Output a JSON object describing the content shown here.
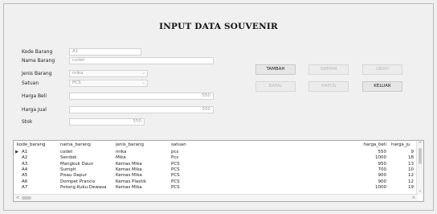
{
  "form": {
    "title": "INPUT DATA SOUVENIR",
    "labels": {
      "kode": "Kode Barang",
      "nama": "Nama Barang",
      "jenis": "Jenis Barang",
      "satuan": "Satuan",
      "harga_beli": "Harga Beli",
      "harga_jual": "Harga Jual",
      "stok": "Stok"
    },
    "values": {
      "kode": "A1",
      "nama": "codet",
      "jenis": "mika",
      "satuan": "PCS",
      "harga_beli": "550",
      "harga_jual": "500",
      "stok": "550"
    }
  },
  "buttons": {
    "tambah": "TAMBAH",
    "simpan": "SIMPAN",
    "ubah": "UBAH",
    "batal": "BATAL",
    "hapus": "HAPUS",
    "keluar": "KELUAR"
  },
  "grid": {
    "columns": [
      "kode_barang",
      "nama_barang",
      "jenis_barang",
      "satuan",
      "harga_beli",
      "harga_ju"
    ],
    "rows": [
      [
        "A1",
        "codet",
        "mika",
        "pcs",
        "550",
        "9"
      ],
      [
        "A2",
        "Sendok",
        "Mika",
        "Pcs",
        "1000",
        "18"
      ],
      [
        "A3",
        "Mangkuk Daun",
        "Kemas Mika",
        "PCS",
        "950",
        "13"
      ],
      [
        "A4",
        "Sumpit",
        "Kemas Mika",
        "PCS",
        "700",
        "10"
      ],
      [
        "A5",
        "Pisau Dapur",
        "Kemas Mika",
        "PCS",
        "900",
        "12"
      ],
      [
        "A6",
        "Dompet Prancis",
        "Kemas Plastik",
        "PCS",
        "900",
        "12"
      ],
      [
        "A7",
        "Potong Kuku Dewasa",
        "Kemas Mika",
        "PCS",
        "1000",
        "19"
      ]
    ],
    "current_row_marker": "▶",
    "scroll": {
      "up": "^",
      "down": "⌄",
      "left": "<",
      "right": ">"
    }
  },
  "icons": {
    "dropdown": "chevron-down-icon"
  }
}
